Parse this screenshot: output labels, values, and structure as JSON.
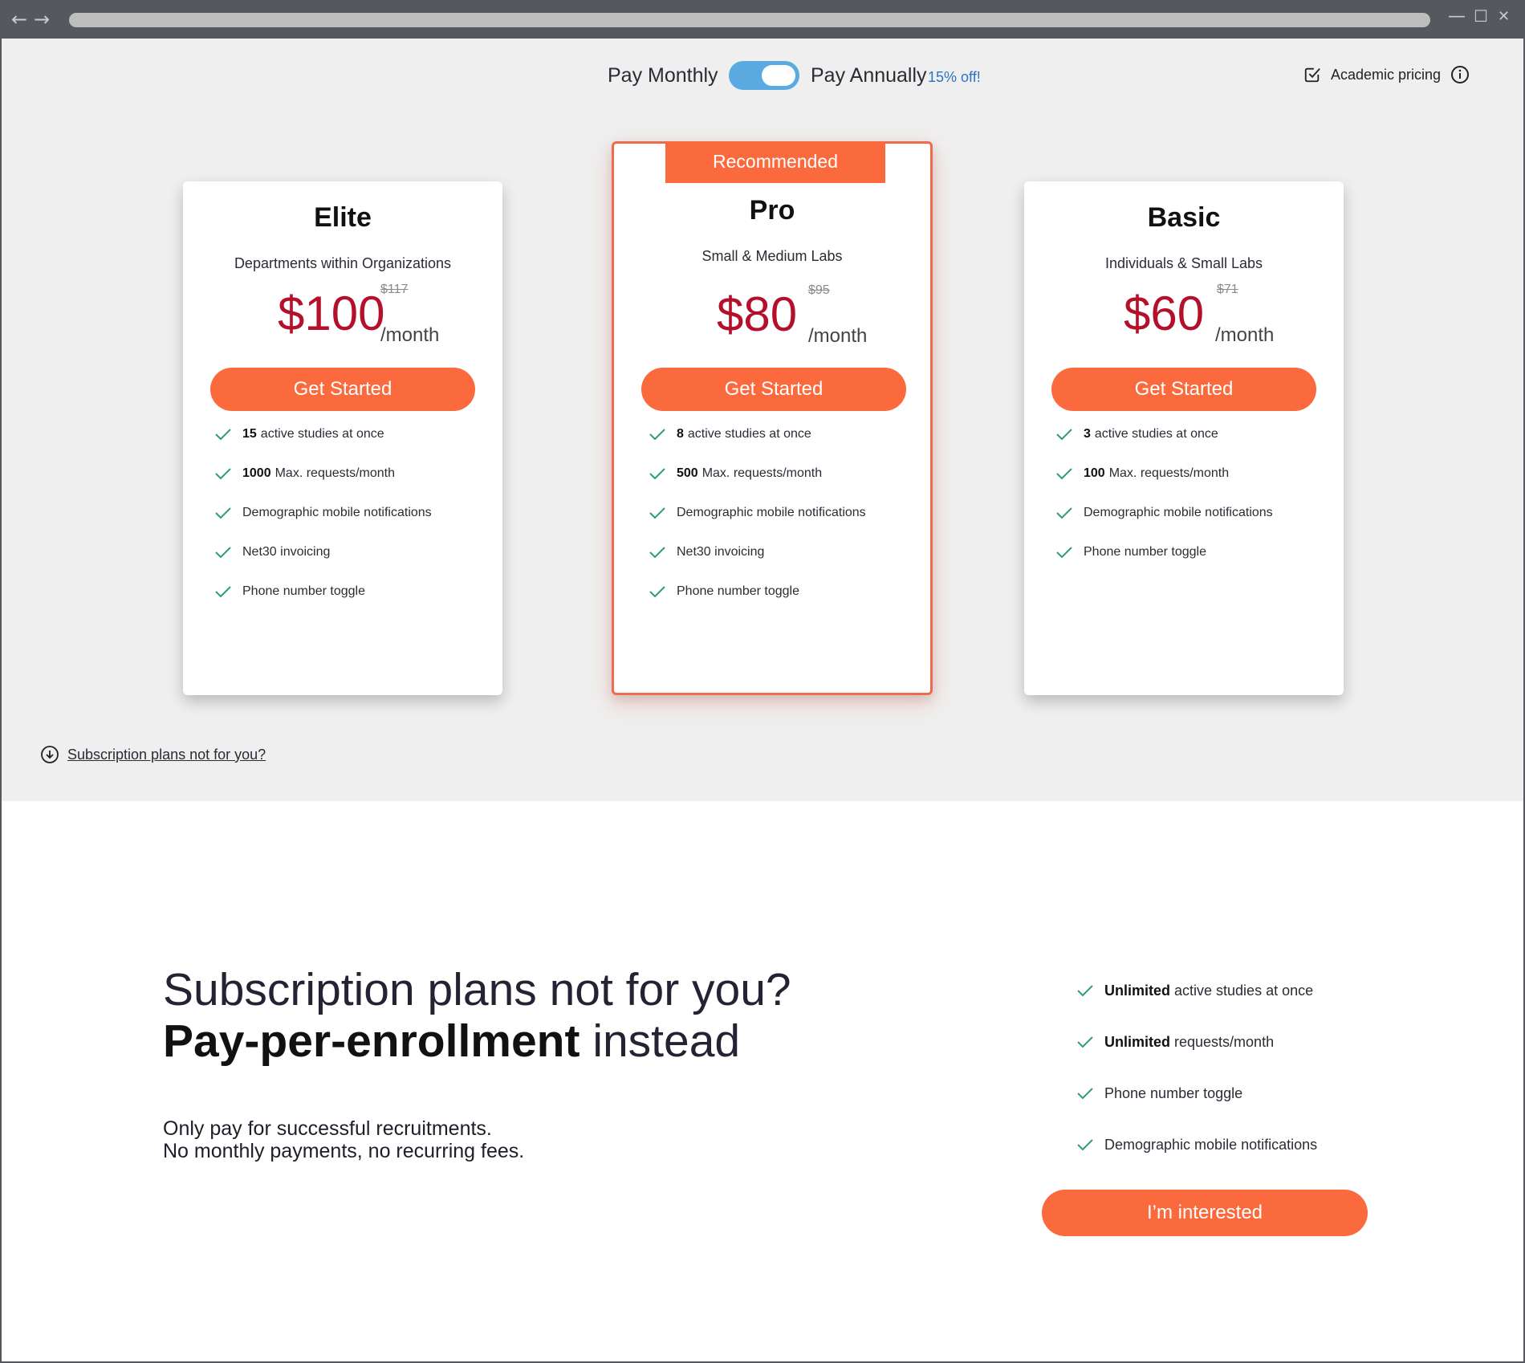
{
  "browser": {
    "back_label": "←",
    "forward_label": "→",
    "minimize_label": "—",
    "maximize_label": "☐",
    "close_label": "✕"
  },
  "billing": {
    "monthly_label": "Pay Monthly",
    "annually_label": "Pay Annually",
    "discount_label": "15% off!",
    "toggle_state": "annually"
  },
  "academic": {
    "label": "Academic pricing",
    "checked": true
  },
  "plans": [
    {
      "name": "Elite",
      "subtitle": "Departments within Organizations",
      "price": "$100",
      "old_price": "$117",
      "period": "/month",
      "cta": "Get Started",
      "features": [
        {
          "bold": "15",
          "text": "active studies at once"
        },
        {
          "bold": "1000",
          "text": "Max. requests/month"
        },
        {
          "bold": "",
          "text": "Demographic mobile notifications"
        },
        {
          "bold": "",
          "text": "Net30 invoicing"
        },
        {
          "bold": "",
          "text": "Phone number toggle"
        }
      ]
    },
    {
      "name": "Pro",
      "badge": "Recommended",
      "subtitle": "Small & Medium Labs",
      "price": "$80",
      "old_price": "$95",
      "period": "/month",
      "cta": "Get Started",
      "features": [
        {
          "bold": "8",
          "text": "active studies at once"
        },
        {
          "bold": "500",
          "text": "Max. requests/month"
        },
        {
          "bold": "",
          "text": "Demographic mobile notifications"
        },
        {
          "bold": "",
          "text": "Net30 invoicing"
        },
        {
          "bold": "",
          "text": "Phone number toggle"
        }
      ]
    },
    {
      "name": "Basic",
      "subtitle": "Individuals & Small Labs",
      "price": "$60",
      "old_price": "$71",
      "period": "/month",
      "cta": "Get Started",
      "features": [
        {
          "bold": "3",
          "text": "active studies at once"
        },
        {
          "bold": "100",
          "text": "Max. requests/month"
        },
        {
          "bold": "",
          "text": "Demographic mobile notifications"
        },
        {
          "bold": "",
          "text": "Phone number toggle"
        }
      ]
    }
  ],
  "not_for_you_link": "Subscription plans not for you?",
  "ppe": {
    "headline_line1": "Subscription plans not for you?",
    "headline_bold": "Pay-per-enrollment",
    "headline_rest": "instead",
    "desc_line1": "Only pay for successful recruitments.",
    "desc_line2": "No monthly payments, no recurring fees.",
    "features": [
      {
        "bold": "Unlimited",
        "text": "active studies at once"
      },
      {
        "bold": "Unlimited",
        "text": "requests/month"
      },
      {
        "bold": "",
        "text": "Phone number toggle"
      },
      {
        "bold": "",
        "text": "Demographic mobile notifications"
      }
    ],
    "cta": "I’m interested"
  },
  "colors": {
    "accent": "#fb6a3d",
    "price": "#b5102b",
    "toggle": "#5aa9e0",
    "discount": "#2f73c2",
    "check": "#2e9e6e",
    "background_top": "#efefef"
  }
}
